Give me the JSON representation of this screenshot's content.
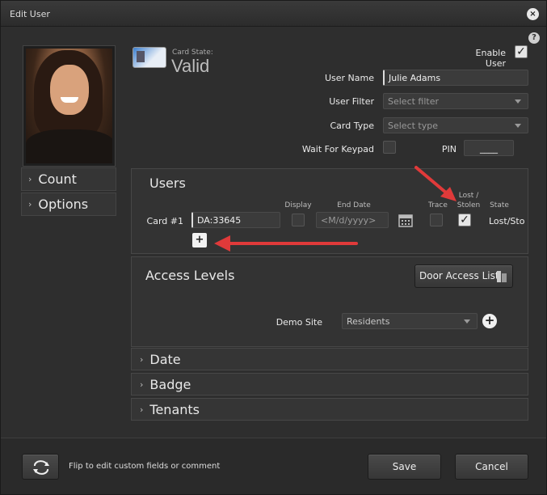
{
  "window": {
    "title": "Edit User"
  },
  "controls": {
    "close": "×",
    "help": "?"
  },
  "card_state": {
    "label": "Card State:",
    "value": "Valid"
  },
  "enable_user": {
    "label": "Enable User",
    "checked": true
  },
  "form": {
    "user_name_label": "User Name",
    "user_name_value": "Julie Adams",
    "user_filter_label": "User Filter",
    "user_filter_value": "Select filter",
    "card_type_label": "Card Type",
    "card_type_value": "Select type",
    "wait_keypad_label": "Wait For Keypad",
    "pin_label": "PIN",
    "pin_value": "____"
  },
  "left_sections": [
    {
      "label": "Count"
    },
    {
      "label": "Options"
    }
  ],
  "users_panel": {
    "title": "Users",
    "col_display": "Display",
    "col_end_date": "End Date",
    "col_trace": "Trace",
    "col_lost_stolen_1": "Lost /",
    "col_lost_stolen_2": "Stolen",
    "col_state": "State",
    "card_label": "Card #1",
    "card_value": "DA:33645",
    "end_date_placeholder": "<M/d/yyyy>",
    "state_value": "Lost/Sto",
    "add_label": "+"
  },
  "access_panel": {
    "title": "Access Levels",
    "door_access_button": "Door Access List",
    "site_label": "Demo Site",
    "site_value": "Residents",
    "add_label": "+"
  },
  "collapsed_sections": [
    {
      "label": "Date"
    },
    {
      "label": "Badge"
    },
    {
      "label": "Tenants"
    }
  ],
  "footer": {
    "flip_text": "Flip to edit custom fields or comment",
    "save_label": "Save",
    "cancel_label": "Cancel"
  },
  "colors": {
    "annotation_arrow": "#e03a3a"
  }
}
